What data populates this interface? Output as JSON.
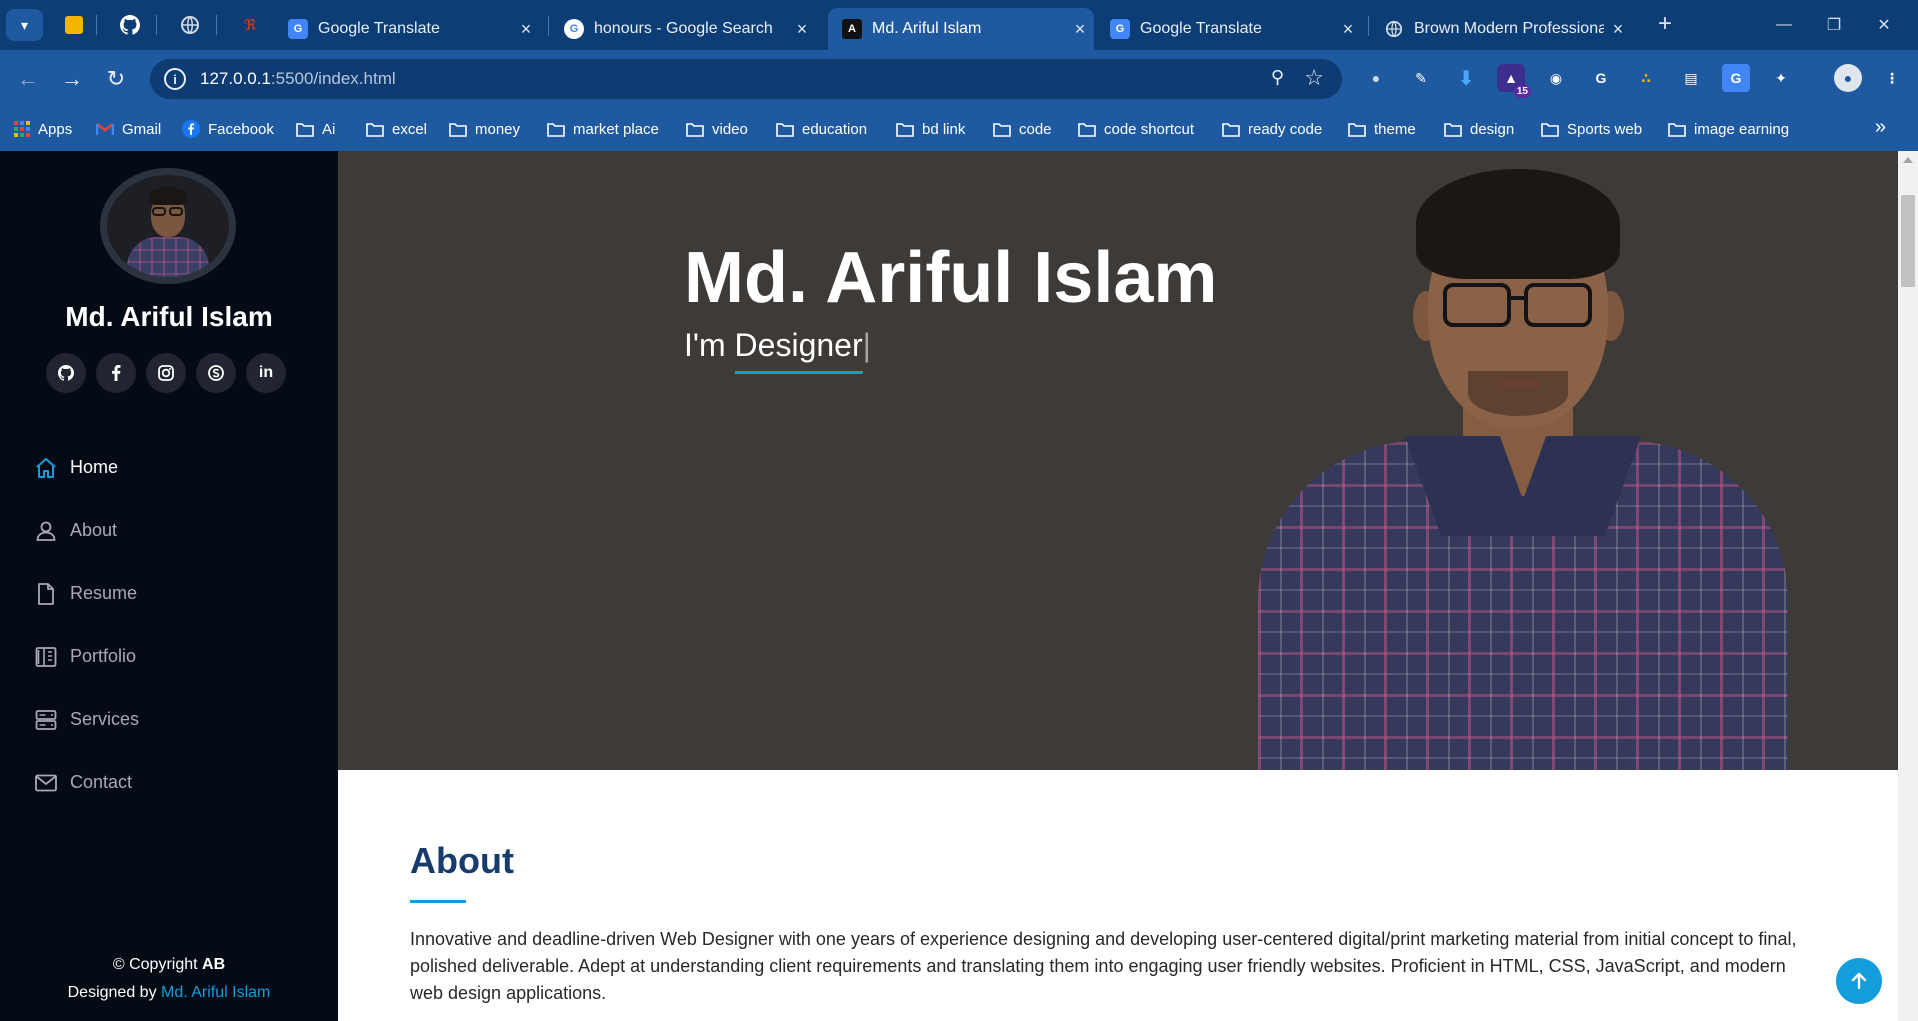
{
  "browser": {
    "tabs": [
      {
        "title": "Google Translate",
        "active": false
      },
      {
        "title": "honours - Google Search",
        "active": false
      },
      {
        "title": "Md. Ariful Islam",
        "active": true
      },
      {
        "title": "Google Translate",
        "active": false
      },
      {
        "title": "Brown Modern Professional",
        "active": false
      }
    ],
    "url_host": "127.0.0.1",
    "url_path": ":5500/index.html",
    "extension_badge": "15",
    "bookmarks": [
      {
        "label": "Apps",
        "icon": "apps-grid-icon"
      },
      {
        "label": "Gmail",
        "icon": "gmail-icon"
      },
      {
        "label": "Facebook",
        "icon": "facebook-icon"
      },
      {
        "label": "Ai",
        "icon": "folder-icon"
      },
      {
        "label": "excel",
        "icon": "folder-icon"
      },
      {
        "label": "money",
        "icon": "folder-icon"
      },
      {
        "label": "market place",
        "icon": "folder-icon"
      },
      {
        "label": "video",
        "icon": "folder-icon"
      },
      {
        "label": "education",
        "icon": "folder-icon"
      },
      {
        "label": "bd link",
        "icon": "folder-icon"
      },
      {
        "label": "code",
        "icon": "folder-icon"
      },
      {
        "label": "code shortcut",
        "icon": "folder-icon"
      },
      {
        "label": "ready code",
        "icon": "folder-icon"
      },
      {
        "label": "theme",
        "icon": "folder-icon"
      },
      {
        "label": "design",
        "icon": "folder-icon"
      },
      {
        "label": "Sports web",
        "icon": "folder-icon"
      },
      {
        "label": "image earning",
        "icon": "folder-icon"
      }
    ]
  },
  "sidebar": {
    "name": "Md. Ariful Islam",
    "socials": [
      "github-icon",
      "facebook-icon",
      "instagram-icon",
      "skype-icon",
      "linkedin-icon"
    ],
    "nav": [
      {
        "label": "Home",
        "icon": "home-icon",
        "active": true
      },
      {
        "label": "About",
        "icon": "person-icon",
        "active": false
      },
      {
        "label": "Resume",
        "icon": "file-icon",
        "active": false
      },
      {
        "label": "Portfolio",
        "icon": "book-half-icon",
        "active": false
      },
      {
        "label": "Services",
        "icon": "server-icon",
        "active": false
      },
      {
        "label": "Contact",
        "icon": "envelope-icon",
        "active": false
      }
    ],
    "footer": {
      "copyright_prefix": "© Copyright ",
      "copyright_brand": "AB",
      "designed_by_prefix": "Designed by ",
      "designer": "Md. Ariful Islam"
    }
  },
  "hero": {
    "title": "Md. Ariful Islam",
    "subtitle_prefix": "I'm ",
    "subtitle_typed": "Designer",
    "cursor": "|"
  },
  "about": {
    "title": "About",
    "text": "Innovative and deadline-driven Web Designer with one years of experience designing and developing user-centered digital/print marketing material from initial concept to final, polished deliverable. Adept at understanding client requirements and translating them into engaging user friendly websites. Proficient in HTML, CSS, JavaScript, and modern web design applications."
  },
  "colors": {
    "accent": "#149ddd",
    "sidebar_bg": "#040b14",
    "hero_bg": "#3e3a37",
    "heading": "#173b6c",
    "chrome_dark": "#0d3d75",
    "chrome": "#1f5aa0"
  }
}
